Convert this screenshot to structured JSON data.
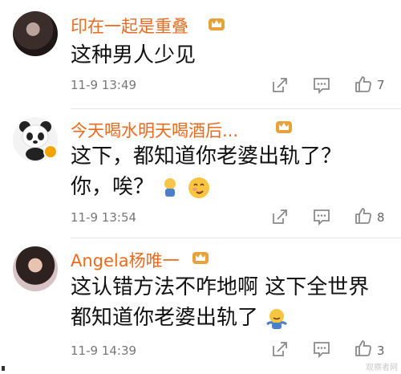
{
  "comments": [
    {
      "username": "印在一起是重叠",
      "text_lines": [
        "这种男人少见"
      ],
      "time": "11-9 13:49",
      "likes": "7"
    },
    {
      "username": "今天喝水明天喝酒后...",
      "text_lines": [
        "这下，都知道你老婆出轨了？",
        "你，唉？"
      ],
      "time": "11-9 13:54",
      "likes": "8"
    },
    {
      "username": "Angela杨唯一",
      "text_lines": [
        "这认错方法不咋地啊 这下全世界",
        "都知道你老婆出轨了"
      ],
      "time": "11-9 14:39",
      "likes": "3"
    }
  ],
  "watermark": "观察者网",
  "colors": {
    "username": "#eb6a1e",
    "crown": "#e7a23a",
    "icon": "#8a8a8a"
  }
}
